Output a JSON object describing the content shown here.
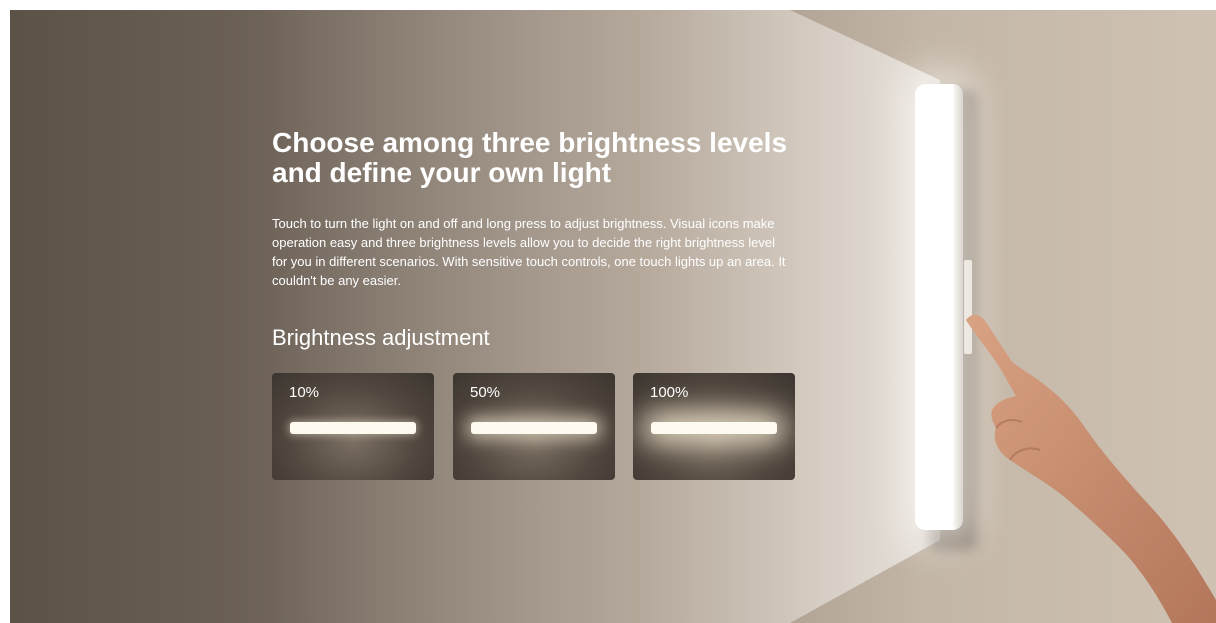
{
  "headline": {
    "line1": "Choose among three brightness levels",
    "line2": "and define your own light"
  },
  "description": "Touch to turn the light on and off and long press to adjust brightness. Visual icons make operation easy and three brightness levels allow you to decide the right brightness level for you in different scenarios. With sensitive touch controls, one touch lights up an area. It couldn't be any easier.",
  "adjustment": {
    "title": "Brightness adjustment",
    "levels": [
      {
        "label": "10%",
        "brightness": 0.1
      },
      {
        "label": "50%",
        "brightness": 0.5
      },
      {
        "label": "100%",
        "brightness": 1.0
      }
    ]
  },
  "colors": {
    "text": "#ffffff",
    "light": "#fffaf0"
  }
}
